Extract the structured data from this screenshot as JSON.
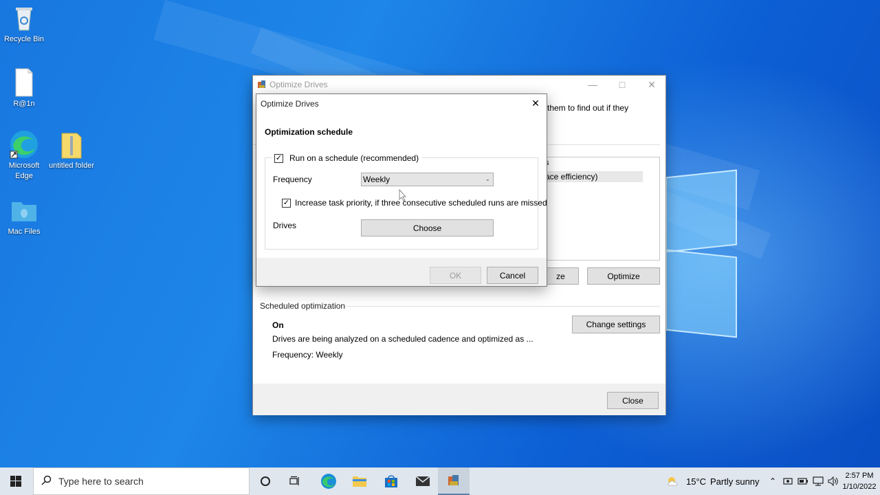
{
  "desktop": {
    "icons": [
      {
        "label": "Recycle Bin"
      },
      {
        "label": "R@1n"
      },
      {
        "label": "Microsoft Edge"
      },
      {
        "label": "untitled folder"
      },
      {
        "label": "Mac Files"
      }
    ]
  },
  "main_window": {
    "title": "Optimize Drives",
    "partial_text_1": "them to find out if they",
    "partial_row_1": "s",
    "partial_row_2": "ace efficiency)",
    "analyze_button_partial": "ze",
    "optimize_button": "Optimize",
    "scheduled_section_title": "Scheduled optimization",
    "status": "On",
    "description": "Drives are being analyzed on a scheduled cadence and optimized as ...",
    "frequency_text": "Frequency: Weekly",
    "change_settings_button": "Change settings",
    "close_button": "Close"
  },
  "dialog": {
    "title": "Optimize Drives",
    "heading": "Optimization schedule",
    "run_on_schedule_label": "Run on a schedule (recommended)",
    "run_on_schedule_checked": true,
    "frequency_label": "Frequency",
    "frequency_value": "Weekly",
    "increase_priority_label": "Increase task priority, if three consecutive scheduled runs are missed",
    "increase_priority_checked": true,
    "drives_label": "Drives",
    "choose_button": "Choose",
    "ok_button": "OK",
    "cancel_button": "Cancel"
  },
  "taskbar": {
    "search_placeholder": "Type here to search",
    "weather_temp": "15°C",
    "weather_text": "Partly sunny",
    "time": "2:57 PM",
    "date": "1/10/2022"
  },
  "colors": {
    "wallpaper_blue": "#1877e0",
    "taskbar": "#dfe6ee",
    "button_face": "#e1e1e1"
  }
}
